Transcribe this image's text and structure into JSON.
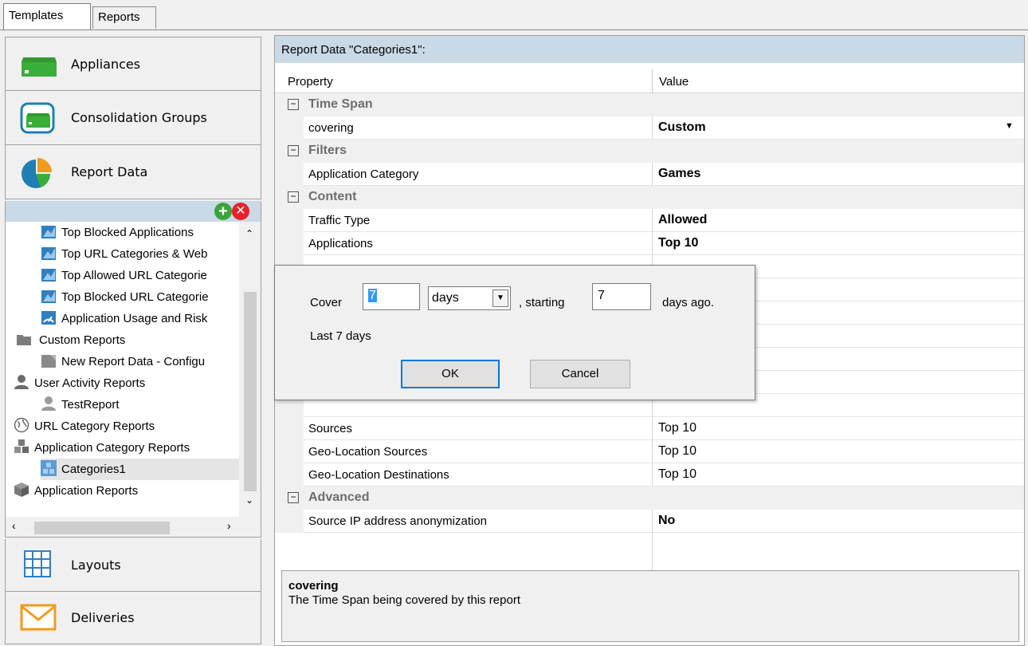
{
  "tabs": [
    {
      "label": "Templates"
    },
    {
      "label": "Reports"
    }
  ],
  "nav": {
    "appliances": "Appliances",
    "consolidation": "Consolidation Groups",
    "report_data": "Report Data",
    "layouts": "Layouts",
    "deliveries": "Deliveries"
  },
  "tree": {
    "items": [
      {
        "label": "Top Blocked Applications"
      },
      {
        "label": "Top URL Categories & Web"
      },
      {
        "label": "Top Allowed URL Categorie"
      },
      {
        "label": "Top Blocked URL Categorie"
      },
      {
        "label": "Application Usage and Risk"
      },
      {
        "label": "Custom Reports"
      },
      {
        "label": "New Report Data - Configu"
      },
      {
        "label": "User Activity Reports"
      },
      {
        "label": "TestReport"
      },
      {
        "label": "URL Category Reports"
      },
      {
        "label": "Application Category Reports"
      },
      {
        "label": "Categories1"
      },
      {
        "label": "Application Reports"
      }
    ]
  },
  "panel": {
    "title": "Report Data \"Categories1\":",
    "col_property": "Property",
    "col_value": "Value"
  },
  "grid": {
    "cat_timespan": "Time Span",
    "covering_name": "covering",
    "covering_value": "Custom",
    "cat_filters": "Filters",
    "appcat_name": "Application Category",
    "appcat_value": "Games",
    "cat_content": "Content",
    "traffic_name": "Traffic Type",
    "traffic_value": "Allowed",
    "apps_name": "Applications",
    "apps_value": "Top 10",
    "sources_name": "Sources",
    "sources_value": "Top 10",
    "geosrc_name": "Geo-Location Sources",
    "geosrc_value": "Top 10",
    "geodst_name": "Geo-Location Destinations",
    "geodst_value": "Top 10",
    "cat_advanced": "Advanced",
    "anon_name": "Source IP address anonymization",
    "anon_value": "No"
  },
  "description": {
    "title": "covering",
    "text": "The Time Span being covered by this report"
  },
  "dialog": {
    "cover_label": "Cover",
    "cover_value": "7",
    "unit_value": "days",
    "starting_label": ", starting",
    "starting_value": "7",
    "ago_label": "days ago.",
    "summary": "Last 7 days",
    "ok": "OK",
    "cancel": "Cancel"
  },
  "colors": {
    "header_band": "#c9d9e6",
    "accent_blue": "#0078d7",
    "add_green": "#3ba33b",
    "delete_red": "#e8212b"
  }
}
